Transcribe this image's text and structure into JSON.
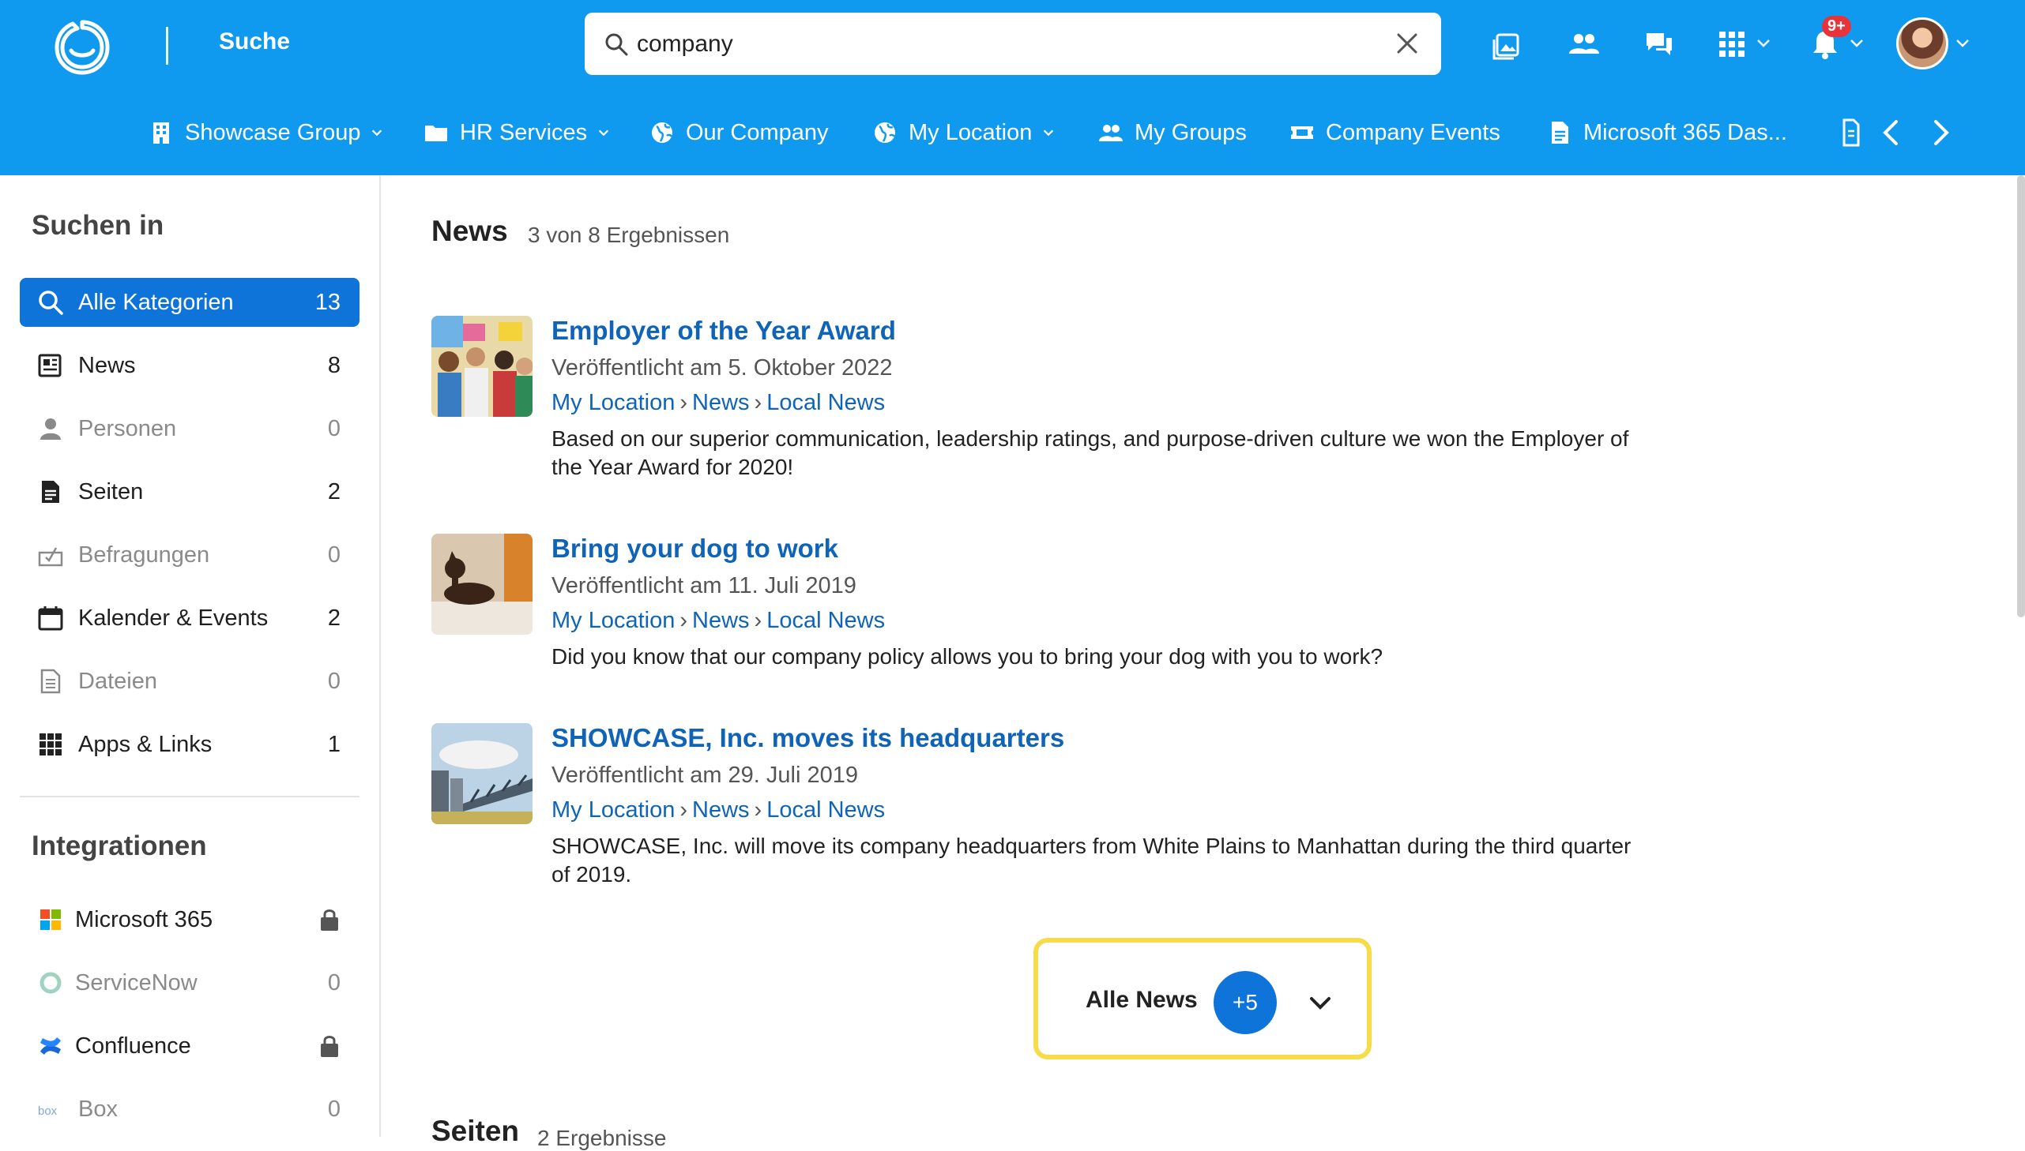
{
  "header": {
    "app_title": "Suche",
    "search": {
      "value": "company",
      "placeholder": ""
    },
    "notification_badge": "9+"
  },
  "nav": {
    "items": [
      {
        "label": "Showcase Group",
        "icon": "building-icon",
        "has_dropdown": true
      },
      {
        "label": "HR Services",
        "icon": "folder-icon",
        "has_dropdown": true
      },
      {
        "label": "Our Company",
        "icon": "globe-icon",
        "has_dropdown": false
      },
      {
        "label": "My Location",
        "icon": "globe-icon",
        "has_dropdown": true
      },
      {
        "label": "My Groups",
        "icon": "groups-icon",
        "has_dropdown": false
      },
      {
        "label": "Company Events",
        "icon": "ticket-icon",
        "has_dropdown": false
      },
      {
        "label": "Microsoft 365 Das...",
        "icon": "document-icon",
        "has_dropdown": false
      }
    ]
  },
  "sidebar": {
    "heading": "Suchen in",
    "categories": [
      {
        "label": "Alle Kategorien",
        "count": "13",
        "icon": "search-icon",
        "active": true
      },
      {
        "label": "News",
        "count": "8",
        "icon": "newspaper-icon"
      },
      {
        "label": "Personen",
        "count": "0",
        "icon": "person-icon",
        "muted": true
      },
      {
        "label": "Seiten",
        "count": "2",
        "icon": "page-icon"
      },
      {
        "label": "Befragungen",
        "count": "0",
        "icon": "survey-icon",
        "muted": true
      },
      {
        "label": "Kalender & Events",
        "count": "2",
        "icon": "calendar-icon"
      },
      {
        "label": "Dateien",
        "count": "0",
        "icon": "file-icon",
        "muted": true
      },
      {
        "label": "Apps & Links",
        "count": "1",
        "icon": "apps-grid-icon"
      }
    ],
    "integrations_heading": "Integrationen",
    "integrations": [
      {
        "label": "Microsoft 365",
        "status": "locked",
        "icon": "microsoft-icon"
      },
      {
        "label": "ServiceNow",
        "count": "0",
        "icon": "servicenow-icon",
        "muted": true
      },
      {
        "label": "Confluence",
        "status": "locked",
        "icon": "confluence-icon"
      },
      {
        "label": "Box",
        "count": "0",
        "icon": "box-icon",
        "muted": true
      }
    ]
  },
  "main": {
    "section_title": "News",
    "section_count": "3 von 8 Ergebnissen",
    "results": [
      {
        "title": "Employer of the Year Award",
        "date": "Veröffentlicht am 5. Oktober 2022",
        "crumbs": [
          "My Location",
          "News",
          "Local News"
        ],
        "text": "Based on our superior communication, leadership ratings, and purpose-driven culture we won the Employer of the Year Award for 2020!"
      },
      {
        "title": "Bring your dog to work",
        "date": "Veröffentlicht am 11. Juli 2019",
        "crumbs": [
          "My Location",
          "News",
          "Local News"
        ],
        "text": "Did you know that our company policy allows you to bring your dog with you to work?"
      },
      {
        "title": "SHOWCASE, Inc. moves its headquarters",
        "date": "Veröffentlicht am 29. Juli 2019",
        "crumbs": [
          "My Location",
          "News",
          "Local News"
        ],
        "text": "SHOWCASE, Inc. will move its company headquarters from White Plains to Manhattan during the third quarter of 2019."
      }
    ],
    "more_button": {
      "label": "Alle News",
      "count": "+5"
    },
    "next_section": {
      "title": "Seiten",
      "count": "2 Ergebnisse"
    }
  },
  "colors": {
    "brand": "#0f9af0",
    "accent": "#0f74d9",
    "link": "#0f64b8",
    "highlight": "#f5dc48"
  }
}
